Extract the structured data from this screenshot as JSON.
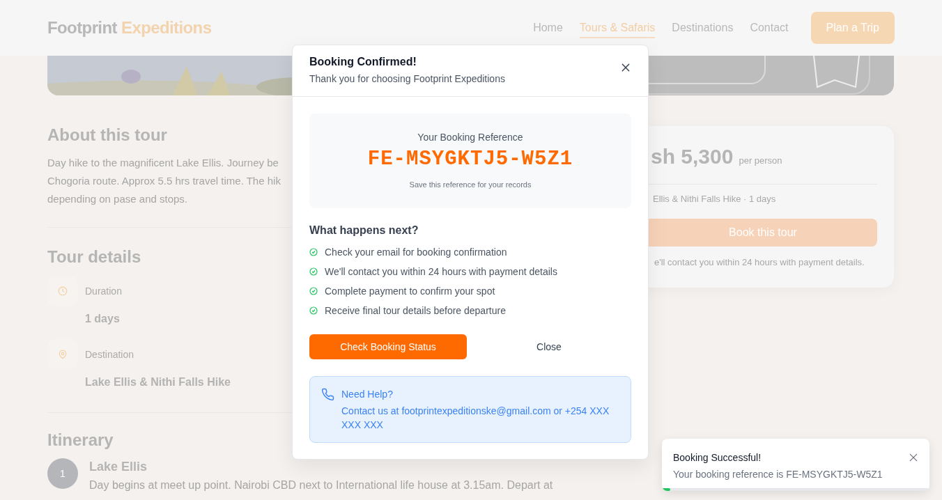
{
  "header": {
    "logo": {
      "primary": "Footprint",
      "accent": "Expeditions"
    },
    "nav": [
      {
        "label": "Home",
        "selected": false
      },
      {
        "label": "Tours & Safaris",
        "selected": true
      },
      {
        "label": "Destinations",
        "selected": false
      },
      {
        "label": "Contact",
        "selected": false
      }
    ],
    "cta": "Plan a Trip"
  },
  "about": {
    "title": "About this tour",
    "lines": [
      "Day hike to the magnificent Lake Ellis. Journey be",
      "Chogoria route. Approx 5.5 hrs travel time. The hik",
      "depending on pase and stops."
    ]
  },
  "tour_details": {
    "title": "Tour details",
    "items": [
      {
        "kind": "duration",
        "label": "Duration",
        "value": "1 days"
      },
      {
        "kind": "destination",
        "label": "Destination",
        "value": "Lake Ellis & Nithi Falls Hike"
      }
    ]
  },
  "itinerary": {
    "title": "Itinerary",
    "items": [
      {
        "number": "1",
        "title": "Lake Ellis",
        "description": "Day begins at meet up point. Nairobi CBD next to International life house at 3.15am. Depart at"
      }
    ]
  },
  "price_card": {
    "price": "sh 5,300",
    "unit": "per person",
    "summary": "Ellis & Nithi Falls Hike · 1 days",
    "button": "Book this tour",
    "note": "e'll contact you within 24 hours with payment details."
  },
  "modal": {
    "title": "Booking Confirmed!",
    "subtitle": "Thank you for choosing Footprint Expeditions",
    "reference": {
      "label": "Your Booking Reference",
      "code": "FE-MSYGKTJ5-W5Z1",
      "caption": "Save this reference for your records"
    },
    "next_title": "What happens next?",
    "steps": [
      "Check your email for booking confirmation",
      "We'll contact you within 24 hours with payment details",
      "Complete payment to confirm your spot",
      "Receive final tour details before departure"
    ],
    "primary_button": "Check Booking Status",
    "secondary_button": "Close",
    "help": {
      "title": "Need Help?",
      "text": "Contact us at footprintexpeditionske@gmail.com or +254 XXX XXX XXX"
    }
  },
  "toast": {
    "title": "Booking Successful!",
    "message": "Your booking reference is FE-MSYGKTJ5-W5Z1",
    "level": 0.03
  }
}
